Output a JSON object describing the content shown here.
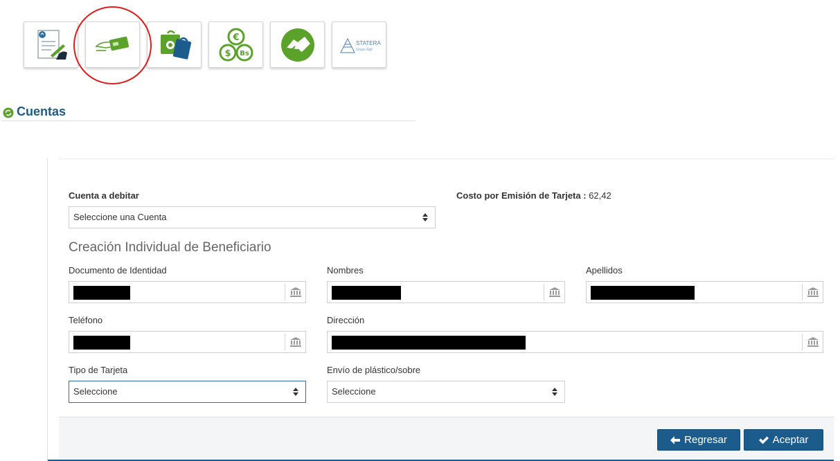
{
  "toolbar": {
    "tiles": [
      {
        "icon": "document-signing-icon"
      },
      {
        "icon": "card-payment-icon"
      },
      {
        "icon": "shopping-bags-icon"
      },
      {
        "icon": "currency-coins-icon"
      },
      {
        "icon": "handshake-icon"
      },
      {
        "icon": "statera-logo-icon",
        "logo_text": "STATERA",
        "logo_subtext": "Grupo Ágil"
      }
    ]
  },
  "section": {
    "title": "Cuentas"
  },
  "form": {
    "cuenta_label": "Cuenta a debitar",
    "cuenta_select_value": "Seleccione una Cuenta",
    "costo_label": "Costo por Emisión de Tarjeta :",
    "costo_value": "62,42",
    "subtitle": "Creación Individual de Beneficiario",
    "documento_label": "Documento de Identidad",
    "nombres_label": "Nombres",
    "apellidos_label": "Apellidos",
    "telefono_label": "Teléfono",
    "direccion_label": "Dirección",
    "tipo_tarjeta_label": "Tipo de Tarjeta",
    "tipo_tarjeta_value": "Seleccione",
    "envio_label": "Envío de plástico/sobre",
    "envio_value": "Seleccione"
  },
  "footer": {
    "back_label": "Regresar",
    "accept_label": "Aceptar"
  },
  "colors": {
    "primary": "#1b5c8c",
    "green": "#5aa22a",
    "highlight": "#e01b1b"
  }
}
